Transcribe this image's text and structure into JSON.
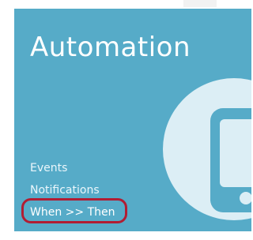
{
  "tile": {
    "title": "Automation",
    "icon": "smartphone-icon",
    "background_color": "#56abc8",
    "menu": [
      {
        "label": "Events",
        "selected": false
      },
      {
        "label": "Notifications",
        "selected": false
      },
      {
        "label": "When >> Then",
        "selected": true
      }
    ]
  },
  "highlight": {
    "target": "When >> Then",
    "color": "#b11d33"
  }
}
